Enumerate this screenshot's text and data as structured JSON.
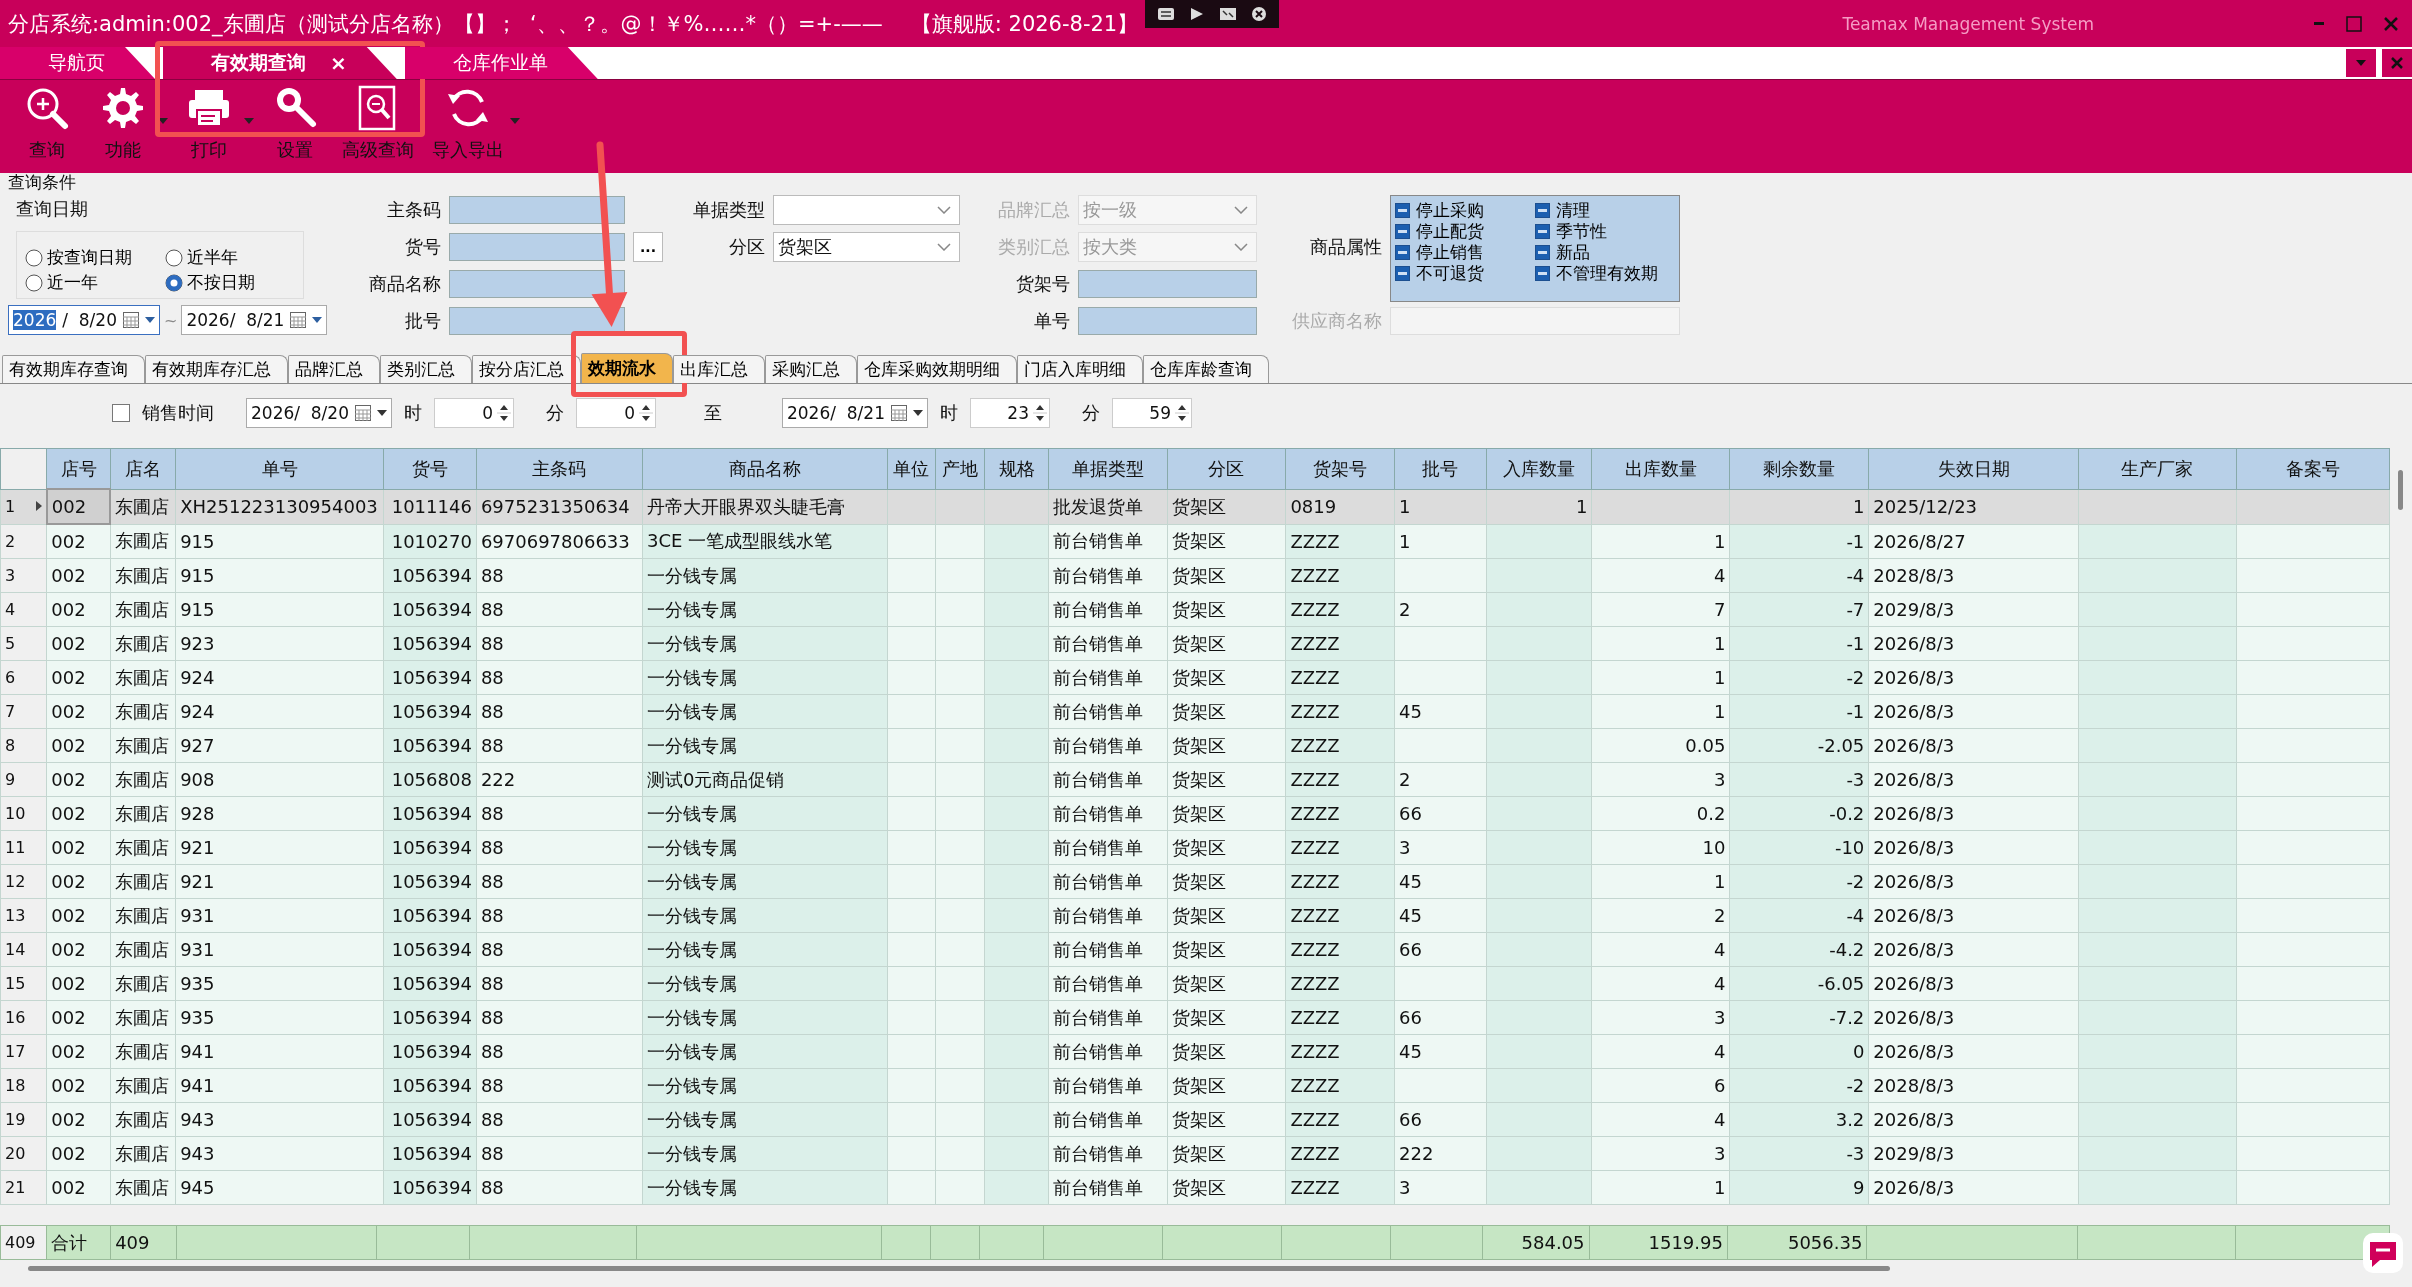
{
  "window": {
    "title": "分店系统:admin:002_东圃店（测试分店名称）【】；  ‘、、？。@！￥%……*（）=+-——",
    "edition": "【旗舰版: 2026-8-21】",
    "brand": "Teamax Management System"
  },
  "document_tabs": [
    {
      "label": "导航页",
      "selected": false,
      "closable": false,
      "highlighted": false
    },
    {
      "label": "有效期查询",
      "selected": true,
      "closable": true,
      "highlighted": true
    },
    {
      "label": "仓库作业单",
      "selected": false,
      "closable": false,
      "highlighted": false
    }
  ],
  "tab_close_glyph": "×",
  "toolbar": [
    {
      "label": "查询",
      "dropdown": false
    },
    {
      "label": "功能",
      "dropdown": true
    },
    {
      "label": "打印",
      "dropdown": true
    },
    {
      "label": "设置",
      "dropdown": false
    },
    {
      "label": "高级查询",
      "dropdown": false
    },
    {
      "label": "导入导出",
      "dropdown": true
    }
  ],
  "query": {
    "group_label": "查询条件",
    "date_label": "查询日期",
    "date_options": [
      {
        "label": "按查询日期",
        "selected": false
      },
      {
        "label": "近半年",
        "selected": false
      },
      {
        "label": "近一年",
        "selected": false
      },
      {
        "label": "不按日期",
        "selected": true
      }
    ],
    "date_from": {
      "selected_part": "2026",
      "rest": "/  8/20"
    },
    "date_separator": "~",
    "date_to": "2026/  8/21",
    "field_columns": [
      [
        {
          "label": "主条码",
          "kind": "text",
          "disabled": false
        },
        {
          "label": "货号",
          "kind": "text",
          "disabled": false,
          "browse": "..."
        },
        {
          "label": "商品名称",
          "kind": "text",
          "disabled": false
        },
        {
          "label": "批号",
          "kind": "text",
          "disabled": false
        }
      ],
      [
        {
          "label": "单据类型",
          "kind": "select",
          "disabled": false
        },
        {
          "label": "分区",
          "kind": "select",
          "disabled": false,
          "value": "货架区"
        }
      ],
      [
        {
          "label": "品牌汇总",
          "kind": "select",
          "disabled": true,
          "value": "按一级"
        },
        {
          "label": "类别汇总",
          "kind": "select",
          "disabled": true,
          "value": "按大类"
        },
        {
          "label": "货架号",
          "kind": "text",
          "disabled": false
        },
        {
          "label": "单号",
          "kind": "text",
          "disabled": false
        }
      ]
    ],
    "supplier": {
      "label": "供应商名称",
      "kind": "text",
      "disabled": true
    },
    "attributes": {
      "label": "商品属性",
      "items": [
        {
          "label": "停止采购",
          "indeterminate": true
        },
        {
          "label": "清理",
          "indeterminate": true
        },
        {
          "label": "停止配货",
          "indeterminate": true
        },
        {
          "label": "季节性",
          "indeterminate": true
        },
        {
          "label": "停止销售",
          "indeterminate": true
        },
        {
          "label": "新品",
          "indeterminate": true
        },
        {
          "label": "不可退货",
          "indeterminate": true
        },
        {
          "label": "不管理有效期",
          "indeterminate": true
        }
      ]
    }
  },
  "result_tabs": [
    {
      "label": "有效期库存查询",
      "selected": false,
      "highlighted": false
    },
    {
      "label": "有效期库存汇总",
      "selected": false,
      "highlighted": false
    },
    {
      "label": "品牌汇总",
      "selected": false,
      "highlighted": false
    },
    {
      "label": "类别汇总",
      "selected": false,
      "highlighted": false
    },
    {
      "label": "按分店汇总",
      "selected": false,
      "highlighted": false
    },
    {
      "label": "效期流水",
      "selected": true,
      "highlighted": true
    },
    {
      "label": "出库汇总",
      "selected": false,
      "highlighted": false
    },
    {
      "label": "采购汇总",
      "selected": false,
      "highlighted": false
    },
    {
      "label": "仓库采购效期明细",
      "selected": false,
      "highlighted": false
    },
    {
      "label": "门店入库明细",
      "selected": false,
      "highlighted": false
    },
    {
      "label": "仓库库龄查询",
      "selected": false,
      "highlighted": false
    }
  ],
  "filter": {
    "checkbox": {
      "label": "销售时间",
      "checked": false
    },
    "from": {
      "date": "2026/  8/20",
      "hour_label": "时",
      "hour": "0",
      "minute_label": "分",
      "minute": "0"
    },
    "to_label": "至",
    "to": {
      "date": "2026/  8/21",
      "hour_label": "时",
      "hour": "23",
      "minute_label": "分",
      "minute": "59"
    }
  },
  "table": {
    "columns": [
      {
        "label": "店号",
        "shaded": false
      },
      {
        "label": "店名",
        "shaded": false
      },
      {
        "label": "单号",
        "shaded": false
      },
      {
        "label": "货号",
        "shaded": true
      },
      {
        "label": "主条码",
        "shaded": false
      },
      {
        "label": "商品名称",
        "shaded": true
      },
      {
        "label": "单位",
        "shaded": false
      },
      {
        "label": "产地",
        "shaded": false
      },
      {
        "label": "规格",
        "shaded": true
      },
      {
        "label": "单据类型",
        "shaded": false
      },
      {
        "label": "分区",
        "shaded": false
      },
      {
        "label": "货架号",
        "shaded": true
      },
      {
        "label": "批号",
        "shaded": false
      },
      {
        "label": "入库数量",
        "shaded": true
      },
      {
        "label": "出库数量",
        "shaded": false
      },
      {
        "label": "剩余数量",
        "shaded": true
      },
      {
        "label": "失效日期",
        "shaded": false
      },
      {
        "label": "生产厂家",
        "shaded": true
      },
      {
        "label": "备案号",
        "shaded": false
      }
    ],
    "rows": [
      {
        "number": "1",
        "selected": true,
        "cells": [
          "002",
          "东圃店",
          "XH251223130954003",
          "1011146",
          "6975231350634",
          "丹帝大开眼界双头睫毛膏",
          null,
          null,
          null,
          "批发退货单",
          "货架区",
          "0819",
          "1",
          "1",
          null,
          "1",
          "2025/12/23",
          null,
          null
        ]
      },
      {
        "number": "2",
        "selected": false,
        "cells": [
          "002",
          "东圃店",
          "915",
          "1010270",
          "6970697806633",
          "3CE 一笔成型眼线水笔",
          null,
          null,
          null,
          "前台销售单",
          "货架区",
          "ZZZZ",
          "1",
          null,
          "1",
          "-1",
          "2026/8/27",
          null,
          null
        ]
      },
      {
        "number": "3",
        "selected": false,
        "cells": [
          "002",
          "东圃店",
          "915",
          "1056394",
          "88",
          "一分钱专属",
          null,
          null,
          null,
          "前台销售单",
          "货架区",
          "ZZZZ",
          null,
          null,
          "4",
          "-4",
          "2028/8/3",
          null,
          null
        ]
      },
      {
        "number": "4",
        "selected": false,
        "cells": [
          "002",
          "东圃店",
          "915",
          "1056394",
          "88",
          "一分钱专属",
          null,
          null,
          null,
          "前台销售单",
          "货架区",
          "ZZZZ",
          "2",
          null,
          "7",
          "-7",
          "2029/8/3",
          null,
          null
        ]
      },
      {
        "number": "5",
        "selected": false,
        "cells": [
          "002",
          "东圃店",
          "923",
          "1056394",
          "88",
          "一分钱专属",
          null,
          null,
          null,
          "前台销售单",
          "货架区",
          "ZZZZ",
          null,
          null,
          "1",
          "-1",
          "2026/8/3",
          null,
          null
        ]
      },
      {
        "number": "6",
        "selected": false,
        "cells": [
          "002",
          "东圃店",
          "924",
          "1056394",
          "88",
          "一分钱专属",
          null,
          null,
          null,
          "前台销售单",
          "货架区",
          "ZZZZ",
          null,
          null,
          "1",
          "-2",
          "2026/8/3",
          null,
          null
        ]
      },
      {
        "number": "7",
        "selected": false,
        "cells": [
          "002",
          "东圃店",
          "924",
          "1056394",
          "88",
          "一分钱专属",
          null,
          null,
          null,
          "前台销售单",
          "货架区",
          "ZZZZ",
          "45",
          null,
          "1",
          "-1",
          "2026/8/3",
          null,
          null
        ]
      },
      {
        "number": "8",
        "selected": false,
        "cells": [
          "002",
          "东圃店",
          "927",
          "1056394",
          "88",
          "一分钱专属",
          null,
          null,
          null,
          "前台销售单",
          "货架区",
          "ZZZZ",
          null,
          null,
          "0.05",
          "-2.05",
          "2026/8/3",
          null,
          null
        ]
      },
      {
        "number": "9",
        "selected": false,
        "cells": [
          "002",
          "东圃店",
          "908",
          "1056808",
          "222",
          "测试0元商品促销",
          null,
          null,
          null,
          "前台销售单",
          "货架区",
          "ZZZZ",
          "2",
          null,
          "3",
          "-3",
          "2026/8/3",
          null,
          null
        ]
      },
      {
        "number": "10",
        "selected": false,
        "cells": [
          "002",
          "东圃店",
          "928",
          "1056394",
          "88",
          "一分钱专属",
          null,
          null,
          null,
          "前台销售单",
          "货架区",
          "ZZZZ",
          "66",
          null,
          "0.2",
          "-0.2",
          "2026/8/3",
          null,
          null
        ]
      },
      {
        "number": "11",
        "selected": false,
        "cells": [
          "002",
          "东圃店",
          "921",
          "1056394",
          "88",
          "一分钱专属",
          null,
          null,
          null,
          "前台销售单",
          "货架区",
          "ZZZZ",
          "3",
          null,
          "10",
          "-10",
          "2026/8/3",
          null,
          null
        ]
      },
      {
        "number": "12",
        "selected": false,
        "cells": [
          "002",
          "东圃店",
          "921",
          "1056394",
          "88",
          "一分钱专属",
          null,
          null,
          null,
          "前台销售单",
          "货架区",
          "ZZZZ",
          "45",
          null,
          "1",
          "-2",
          "2026/8/3",
          null,
          null
        ]
      },
      {
        "number": "13",
        "selected": false,
        "cells": [
          "002",
          "东圃店",
          "931",
          "1056394",
          "88",
          "一分钱专属",
          null,
          null,
          null,
          "前台销售单",
          "货架区",
          "ZZZZ",
          "45",
          null,
          "2",
          "-4",
          "2026/8/3",
          null,
          null
        ]
      },
      {
        "number": "14",
        "selected": false,
        "cells": [
          "002",
          "东圃店",
          "931",
          "1056394",
          "88",
          "一分钱专属",
          null,
          null,
          null,
          "前台销售单",
          "货架区",
          "ZZZZ",
          "66",
          null,
          "4",
          "-4.2",
          "2026/8/3",
          null,
          null
        ]
      },
      {
        "number": "15",
        "selected": false,
        "cells": [
          "002",
          "东圃店",
          "935",
          "1056394",
          "88",
          "一分钱专属",
          null,
          null,
          null,
          "前台销售单",
          "货架区",
          "ZZZZ",
          null,
          null,
          "4",
          "-6.05",
          "2026/8/3",
          null,
          null
        ]
      },
      {
        "number": "16",
        "selected": false,
        "cells": [
          "002",
          "东圃店",
          "935",
          "1056394",
          "88",
          "一分钱专属",
          null,
          null,
          null,
          "前台销售单",
          "货架区",
          "ZZZZ",
          "66",
          null,
          "3",
          "-7.2",
          "2026/8/3",
          null,
          null
        ]
      },
      {
        "number": "17",
        "selected": false,
        "cells": [
          "002",
          "东圃店",
          "941",
          "1056394",
          "88",
          "一分钱专属",
          null,
          null,
          null,
          "前台销售单",
          "货架区",
          "ZZZZ",
          "45",
          null,
          "4",
          "0",
          "2026/8/3",
          null,
          null
        ]
      },
      {
        "number": "18",
        "selected": false,
        "cells": [
          "002",
          "东圃店",
          "941",
          "1056394",
          "88",
          "一分钱专属",
          null,
          null,
          null,
          "前台销售单",
          "货架区",
          "ZZZZ",
          null,
          null,
          "6",
          "-2",
          "2028/8/3",
          null,
          null
        ]
      },
      {
        "number": "19",
        "selected": false,
        "cells": [
          "002",
          "东圃店",
          "943",
          "1056394",
          "88",
          "一分钱专属",
          null,
          null,
          null,
          "前台销售单",
          "货架区",
          "ZZZZ",
          "66",
          null,
          "4",
          "3.2",
          "2026/8/3",
          null,
          null
        ]
      },
      {
        "number": "20",
        "selected": false,
        "cells": [
          "002",
          "东圃店",
          "943",
          "1056394",
          "88",
          "一分钱专属",
          null,
          null,
          null,
          "前台销售单",
          "货架区",
          "ZZZZ",
          "222",
          null,
          "3",
          "-3",
          "2029/8/3",
          null,
          null
        ]
      },
      {
        "number": "21",
        "selected": false,
        "cells": [
          "002",
          "东圃店",
          "945",
          "1056394",
          "88",
          "一分钱专属",
          null,
          null,
          null,
          "前台销售单",
          "货架区",
          "ZZZZ",
          "3",
          null,
          "1",
          "9",
          "2026/8/3",
          null,
          null
        ]
      }
    ],
    "totals": {
      "number": "409",
      "cells": [
        "合计",
        "409",
        null,
        null,
        null,
        null,
        null,
        null,
        null,
        null,
        null,
        null,
        null,
        "584.05",
        "1519.95",
        "5056.35",
        null,
        null,
        null
      ]
    }
  }
}
